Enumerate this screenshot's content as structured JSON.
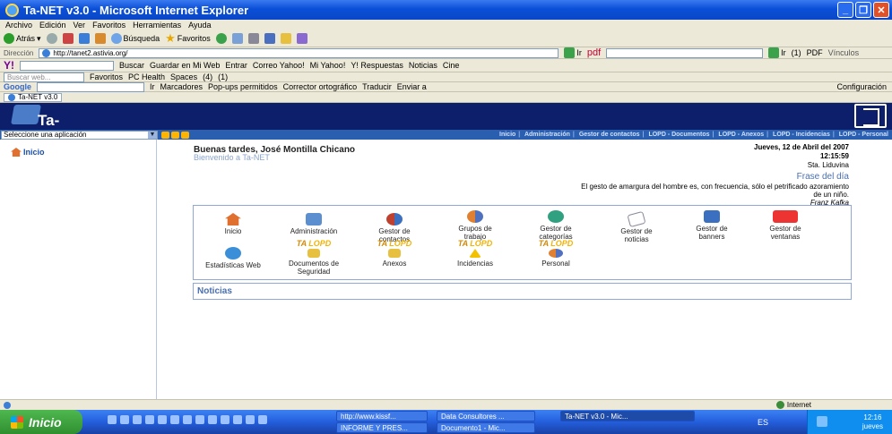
{
  "window": {
    "title": "Ta-NET v3.0 - Microsoft Internet Explorer",
    "menu": [
      "Archivo",
      "Edición",
      "Ver",
      "Favoritos",
      "Herramientas",
      "Ayuda"
    ]
  },
  "toolbar": {
    "back": "Atrás",
    "search": "Búsqueda",
    "favorites": "Favoritos",
    "address_label": "Dirección",
    "address": "http://tanet2.astivia.org/",
    "go": "Ir",
    "pdf": "pdf"
  },
  "yahoo_bar": {
    "buscar": "Buscar",
    "guardar": "Guardar en Mi Web",
    "entrar": "Entrar",
    "correo": "Correo Yahoo!",
    "mi_yahoo": "Mi Yahoo!",
    "respuestas": "Y! Respuestas",
    "noticias": "Noticias",
    "cine": "Cine",
    "search_placeholder": "Buscar web...",
    "favoritos": "Favoritos",
    "pc_health": "PC Health",
    "spaces": "Spaces",
    "count4": "(4)",
    "count1": "(1)",
    "pdf_label": "PDF",
    "vinculos": "Vínculos"
  },
  "google_bar": {
    "label": "Google",
    "ir": "Ir",
    "marcadores": "Marcadores",
    "popups": "Pop-ups permitidos",
    "corrector": "Corrector ortográfico",
    "traducir": "Traducir",
    "enviar": "Enviar a",
    "configuracion": "Configuración"
  },
  "tabs": {
    "current": "Ta-NET v3.0"
  },
  "app": {
    "logo": "Ta-NET",
    "select_placeholder": "Seleccione una aplicación",
    "nav": [
      "Inicio",
      "Administración",
      "Gestor de contactos",
      "LOPD - Documentos",
      "LOPD - Anexos",
      "LOPD - Incidencias",
      "LOPD - Personal"
    ],
    "sidebar_inicio": "Inicio"
  },
  "content": {
    "greeting": "Buenas tardes, José Montilla Chicano",
    "welcome": "Bienvenido a Ta-NET",
    "date": "Jueves, 12 de Abril del 2007",
    "time": "12:15:59",
    "saint": "Sta. Liduvina",
    "phrase_title": "Frase del día",
    "phrase_text": "El gesto de amargura del hombre es, con frecuencia, sólo el petrificado azoramiento de un niño.",
    "phrase_author": "Franz Kafka",
    "tiles": [
      "Inicio",
      "Administración",
      "Gestor de contactos",
      "Grupos de trabajo",
      "Gestor de categorías",
      "Gestor de noticias",
      "Gestor de banners",
      "Gestor de ventanas",
      "Estadísticas Web",
      "Documentos de Seguridad",
      "Anexos",
      "Incidencias",
      "Personal"
    ],
    "lopd_ta": "TA",
    "lopd": "LOPD",
    "noticias": "Noticias"
  },
  "status": {
    "zone": "Internet"
  },
  "taskbar": {
    "start": "Inicio",
    "tasks": [
      "http://www.kissf...",
      "Data Consultores ...",
      "Ta-NET v3.0 - Mic...",
      "INFORME Y PRES...",
      "Documento1 - Mic..."
    ],
    "lang": "ES",
    "clock": "12:16",
    "day": "jueves"
  },
  "colors": {
    "header": "#0d1f6b",
    "navbar": "#2a5fb0",
    "taskbar": "#245edc",
    "start": "#2f8f2f"
  }
}
